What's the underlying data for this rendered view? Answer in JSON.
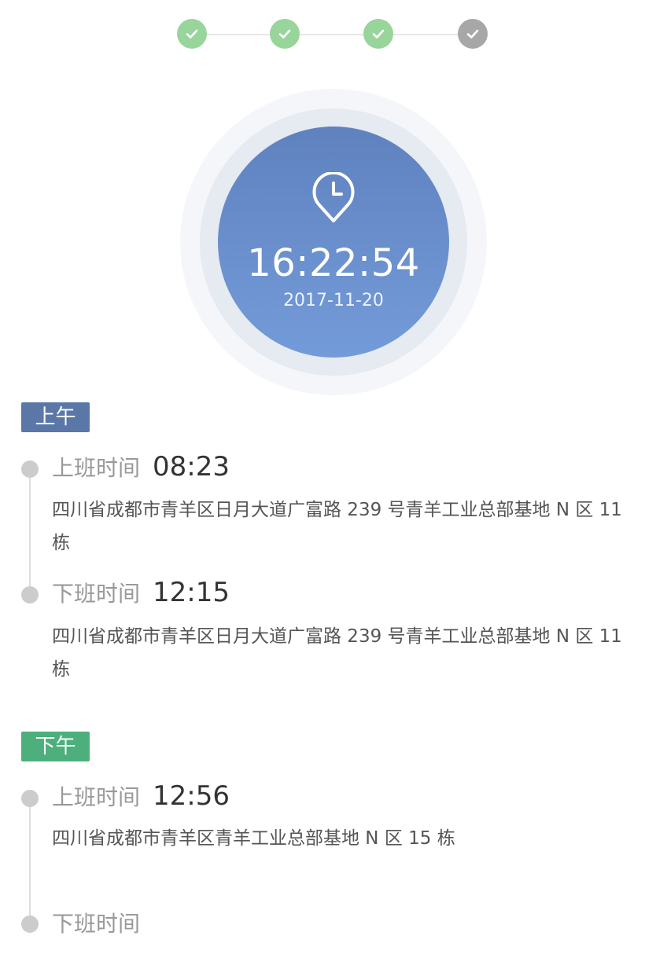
{
  "steps": {
    "items": [
      {
        "status": "done",
        "icon": "check-icon"
      },
      {
        "status": "done",
        "icon": "check-icon"
      },
      {
        "status": "done",
        "icon": "check-icon"
      },
      {
        "status": "current",
        "icon": "check-icon"
      }
    ],
    "done_color": "#98d59a",
    "current_color": "#a7a7a7"
  },
  "clock": {
    "icon": "clock-location-icon",
    "time": "16:22:54",
    "date": "2017-11-20"
  },
  "sections": {
    "am": {
      "label": "上午",
      "color": "#5a77a8",
      "records": [
        {
          "label": "上班时间",
          "time": "08:23",
          "address": "四川省成都市青羊区日月大道广富路 239 号青羊工业总部基地 N 区 11 栋"
        },
        {
          "label": "下班时间",
          "time": "12:15",
          "address": "四川省成都市青羊区日月大道广富路 239 号青羊工业总部基地 N 区 11 栋"
        }
      ]
    },
    "pm": {
      "label": "下午",
      "color": "#4daf7c",
      "records": [
        {
          "label": "上班时间",
          "time": "12:56",
          "address": "四川省成都市青羊区青羊工业总部基地 N 区 15 栋"
        },
        {
          "label": "下班时间",
          "time": "",
          "address": ""
        }
      ]
    }
  }
}
